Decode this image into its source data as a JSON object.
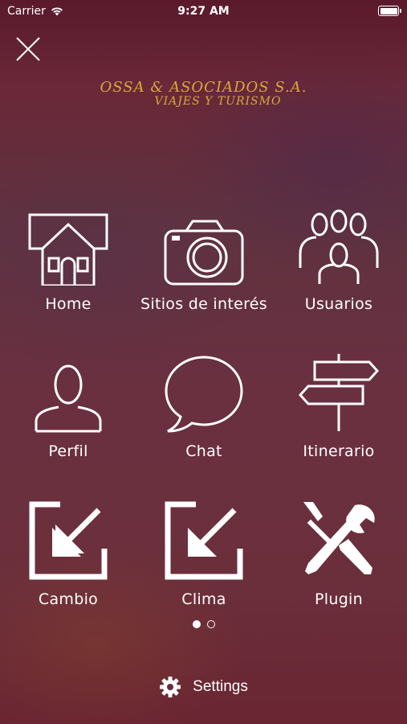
{
  "status_bar": {
    "carrier": "Carrier",
    "time": "9:27 AM"
  },
  "brand": {
    "name": "OSSA & ASOCIADOS S.A.",
    "subtitle": "VIAJES Y TURISMO",
    "color": "#d9a83c"
  },
  "menu": [
    {
      "label": "Home",
      "icon": "house-icon"
    },
    {
      "label": "Sitios de interés",
      "icon": "camera-icon"
    },
    {
      "label": "Usuarios",
      "icon": "users-group-icon"
    },
    {
      "label": "Perfil",
      "icon": "person-icon"
    },
    {
      "label": "Chat",
      "icon": "chat-bubble-icon"
    },
    {
      "label": "Itinerario",
      "icon": "signpost-icon"
    },
    {
      "label": "Cambio",
      "icon": "arrow-in-box-icon"
    },
    {
      "label": "Clima",
      "icon": "arrow-in-box-icon"
    },
    {
      "label": "Plugin",
      "icon": "tools-icon"
    }
  ],
  "pager": {
    "current_page": 1,
    "total_pages": 2
  },
  "settings": {
    "label": "Settings",
    "icon": "gear-icon"
  }
}
